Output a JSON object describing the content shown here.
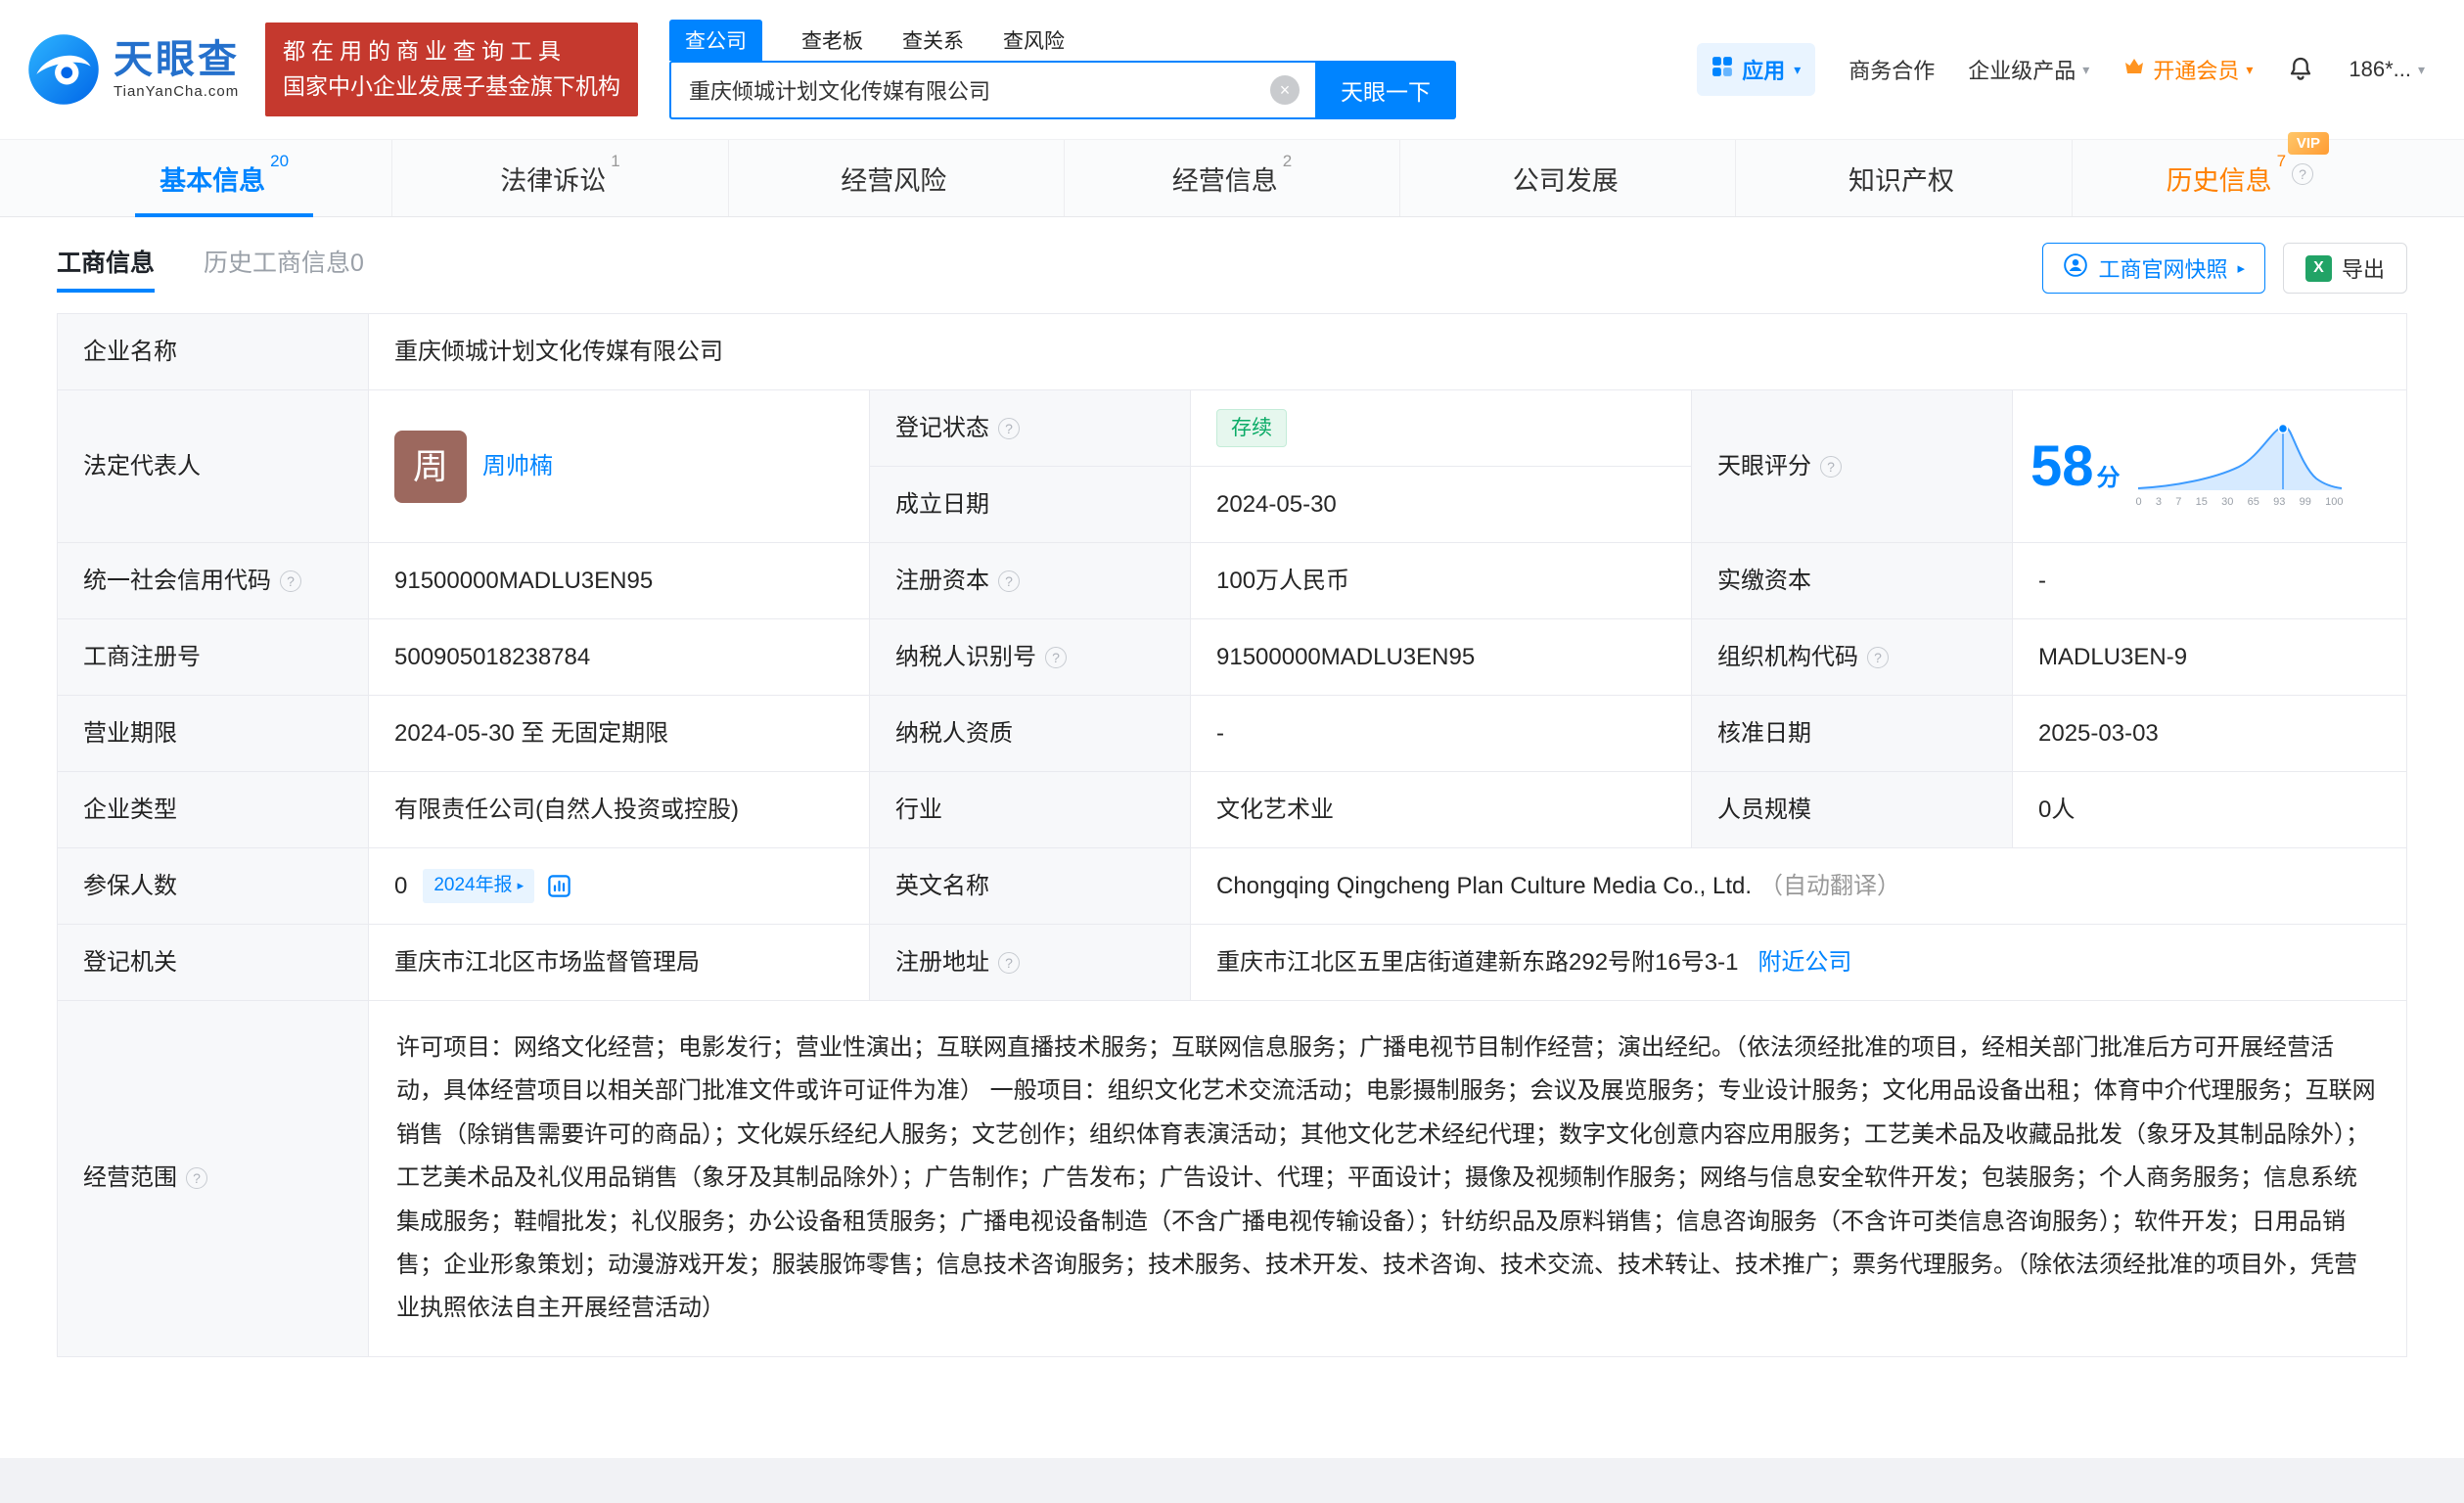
{
  "colors": {
    "primary_blue": "#0084ff",
    "brand_red": "#c5392e",
    "vip_orange": "#ff8000",
    "status_green": "#0bab67",
    "status_green_bg": "#e6f7ee"
  },
  "icons": {
    "help": "?",
    "clear": "×",
    "caret_down": "▾",
    "arrow_right": "▸",
    "excel": "X"
  },
  "header": {
    "logo": {
      "brand": "天眼查",
      "domain": "TianYanCha.com"
    },
    "slogan": {
      "line1": "都在用的商业查询工具",
      "line2": "国家中小企业发展子基金旗下机构"
    },
    "search_tabs": [
      {
        "label": "查公司"
      },
      {
        "label": "查老板"
      },
      {
        "label": "查关系"
      },
      {
        "label": "查风险"
      }
    ],
    "search": {
      "value": "重庆倾城计划文化传媒有限公司",
      "button": "天眼一下"
    },
    "nav": {
      "apps": "应用",
      "cooperation": "商务合作",
      "enterprise": "企业级产品",
      "vip": "开通会员",
      "phone": "186*..."
    }
  },
  "tabs": [
    {
      "label": "基本信息",
      "count": "20"
    },
    {
      "label": "法律诉讼",
      "count": "1"
    },
    {
      "label": "经营风险",
      "count": ""
    },
    {
      "label": "经营信息",
      "count": "2"
    },
    {
      "label": "公司发展",
      "count": ""
    },
    {
      "label": "知识产权",
      "count": ""
    },
    {
      "label": "历史信息",
      "count": "7",
      "vip": "VIP"
    }
  ],
  "subtabs": {
    "current": "工商信息",
    "history": "历史工商信息0",
    "snapshot_btn": "工商官网快照",
    "export_btn": "导出"
  },
  "info": {
    "company_name_label": "企业名称",
    "company_name": "重庆倾城计划文化传媒有限公司",
    "legal_rep_label": "法定代表人",
    "legal_rep_avatar": "周",
    "legal_rep_name": "周帅楠",
    "reg_status_label": "登记状态",
    "reg_status": "存续",
    "establish_date_label": "成立日期",
    "establish_date": "2024-05-30",
    "score_label": "天眼评分",
    "score_value": "58",
    "score_unit": "分",
    "score_axis": [
      "0",
      "3",
      "7",
      "15",
      "30",
      "65",
      "93",
      "99",
      "100"
    ],
    "credit_code_label": "统一社会信用代码",
    "credit_code": "91500000MADLU3EN95",
    "reg_capital_label": "注册资本",
    "reg_capital": "100万人民币",
    "paid_capital_label": "实缴资本",
    "paid_capital": "-",
    "reg_number_label": "工商注册号",
    "reg_number": "500905018238784",
    "taxpayer_id_label": "纳税人识别号",
    "taxpayer_id": "91500000MADLU3EN95",
    "org_code_label": "组织机构代码",
    "org_code": "MADLU3EN-9",
    "business_term_label": "营业期限",
    "business_term": "2024-05-30 至 无固定期限",
    "taxpayer_quality_label": "纳税人资质",
    "taxpayer_quality": "-",
    "approval_date_label": "核准日期",
    "approval_date": "2025-03-03",
    "company_type_label": "企业类型",
    "company_type": "有限责任公司(自然人投资或控股)",
    "industry_label": "行业",
    "industry": "文化艺术业",
    "staff_size_label": "人员规模",
    "staff_size": "0人",
    "insured_label": "参保人数",
    "insured_value": "0",
    "insured_badge": "2024年报",
    "english_name_label": "英文名称",
    "english_name": "Chongqing Qingcheng Plan Culture Media Co., Ltd.",
    "english_name_note": "（自动翻译）",
    "registry_label": "登记机关",
    "registry": "重庆市江北区市场监督管理局",
    "address_label": "注册地址",
    "address": "重庆市江北区五里店街道建新东路292号附16号3-1",
    "nearby_link": "附近公司",
    "scope_label": "经营范围",
    "scope": "许可项目：网络文化经营；电影发行；营业性演出；互联网直播技术服务；互联网信息服务；广播电视节目制作经营；演出经纪。（依法须经批准的项目，经相关部门批准后方可开展经营活动，具体经营项目以相关部门批准文件或许可证件为准） 一般项目：组织文化艺术交流活动；电影摄制服务；会议及展览服务；专业设计服务；文化用品设备出租；体育中介代理服务；互联网销售（除销售需要许可的商品）；文化娱乐经纪人服务；文艺创作；组织体育表演活动；其他文化艺术经纪代理；数字文化创意内容应用服务；工艺美术品及收藏品批发（象牙及其制品除外）；工艺美术品及礼仪用品销售（象牙及其制品除外）；广告制作；广告发布；广告设计、代理；平面设计；摄像及视频制作服务；网络与信息安全软件开发；包装服务；个人商务服务；信息系统集成服务；鞋帽批发；礼仪服务；办公设备租赁服务；广播电视设备制造（不含广播电视传输设备）；针纺织品及原料销售；信息咨询服务（不含许可类信息咨询服务）；软件开发；日用品销售；企业形象策划；动漫游戏开发；服装服饰零售；信息技术咨询服务；技术服务、技术开发、技术咨询、技术交流、技术转让、技术推广；票务代理服务。（除依法须经批准的项目外，凭营业执照依法自主开展经营活动）"
  }
}
